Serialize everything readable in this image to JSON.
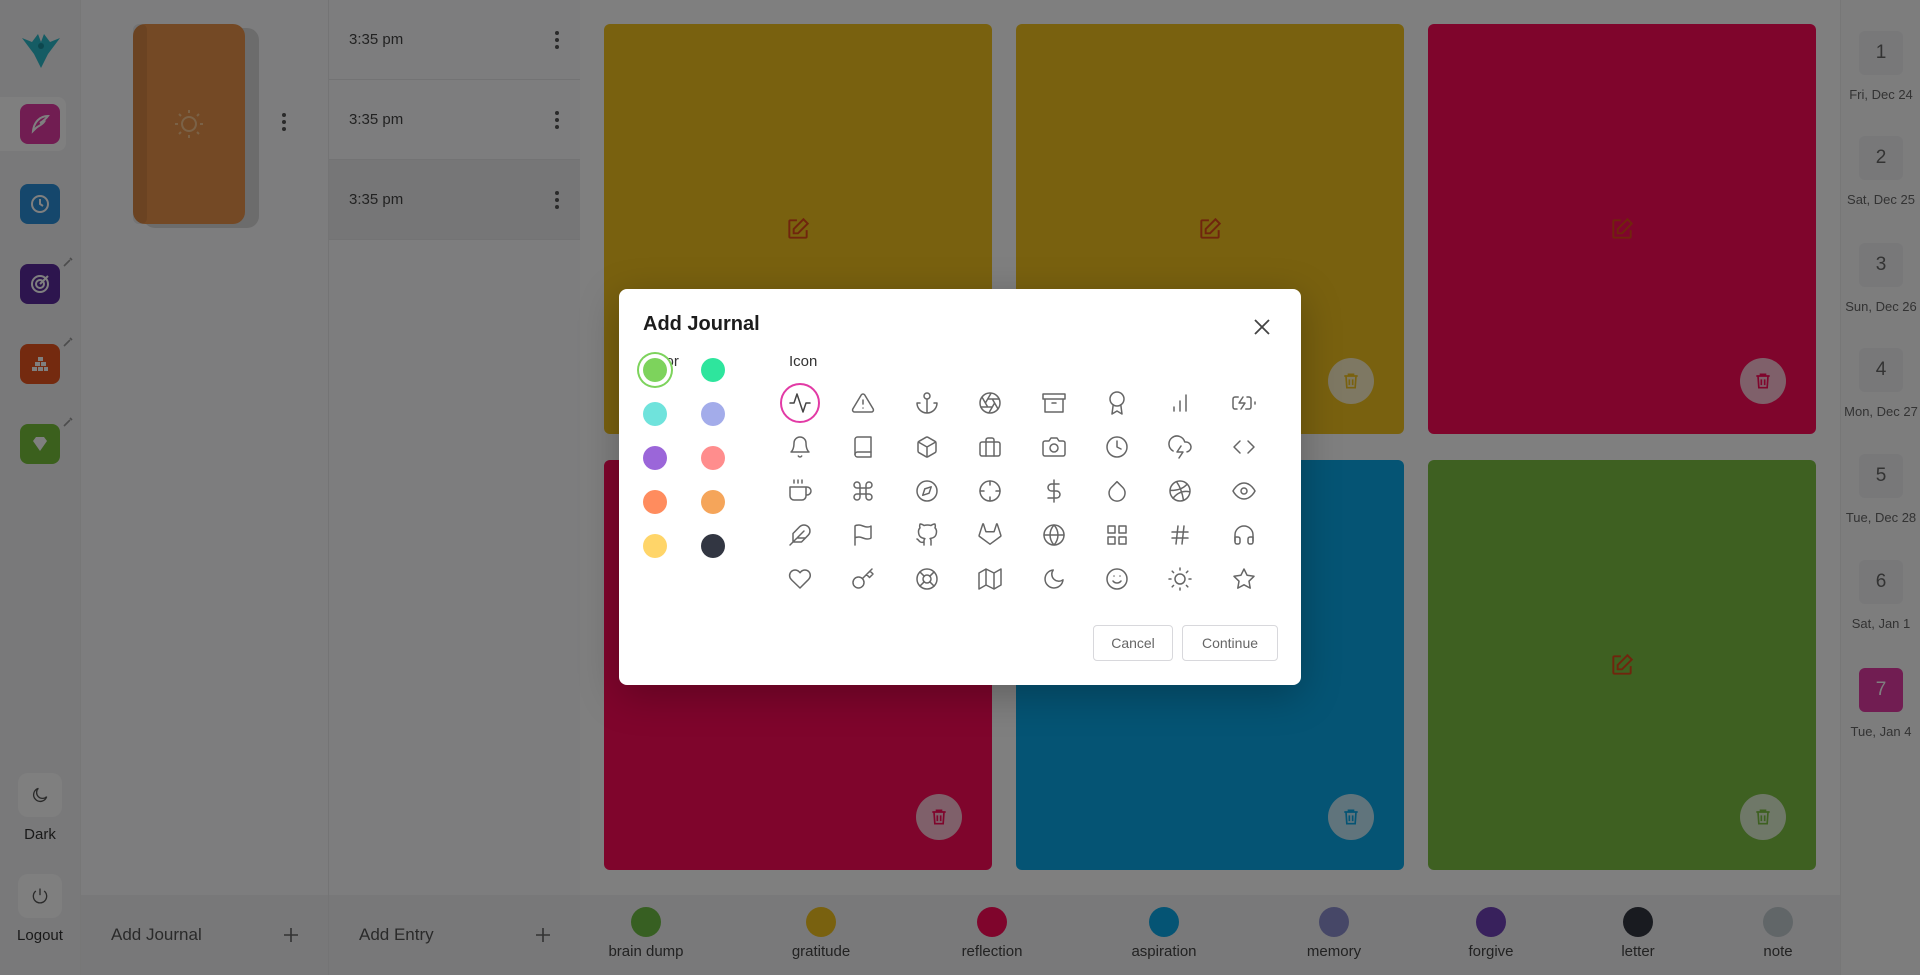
{
  "sidebar": {
    "apps": [
      {
        "name": "journal",
        "color": "#e23aa5",
        "active": true
      },
      {
        "name": "history",
        "color": "#2a8fd8"
      },
      {
        "name": "goals",
        "color": "#5b2a9c"
      },
      {
        "name": "habits",
        "color": "#e8551e"
      },
      {
        "name": "gems",
        "color": "#76c03a"
      }
    ],
    "mode_label": "Dark",
    "logout_label": "Logout"
  },
  "journals": {
    "book_color": "#e9934a",
    "add_label": "Add Journal"
  },
  "entries": {
    "items": [
      {
        "time": "3:35 pm"
      },
      {
        "time": "3:35 pm"
      },
      {
        "time": "3:35 pm"
      }
    ],
    "add_label": "Add Entry"
  },
  "cards": [
    {
      "color": "#f2c31e"
    },
    {
      "color": "#f2c31e"
    },
    {
      "color": "#ff0a58"
    },
    {
      "color": "#ff0a58"
    },
    {
      "color": "#0aa8e8"
    },
    {
      "color": "#7cc143"
    }
  ],
  "legend": [
    {
      "label": "brain dump",
      "color": "#6fbe45"
    },
    {
      "label": "gratitude",
      "color": "#f2c31e"
    },
    {
      "label": "reflection",
      "color": "#ff0a58"
    },
    {
      "label": "aspiration",
      "color": "#0aa8e8"
    },
    {
      "label": "memory",
      "color": "#8c8fcf"
    },
    {
      "label": "forgive",
      "color": "#7043b8"
    },
    {
      "label": "letter",
      "color": "#333640"
    },
    {
      "label": "note",
      "color": "#c3ccd0"
    }
  ],
  "calendar": [
    {
      "num": "1",
      "date": "Fri, Dec 24"
    },
    {
      "num": "2",
      "date": "Sat, Dec 25"
    },
    {
      "num": "3",
      "date": "Sun, Dec 26"
    },
    {
      "num": "4",
      "date": "Mon, Dec 27"
    },
    {
      "num": "5",
      "date": "Tue, Dec 28"
    },
    {
      "num": "6",
      "date": "Sat, Jan 1"
    },
    {
      "num": "7",
      "date": "Tue, Jan 4",
      "active": true
    }
  ],
  "modal": {
    "title": "Add Journal",
    "color_label": "Color",
    "icon_label": "Icon",
    "colors": [
      "#7dd35c",
      "#2ee59d",
      "#6fe3dc",
      "#a3acea",
      "#9b66d9",
      "#ff8d8d",
      "#ff8c5e",
      "#f5a55a",
      "#ffd569",
      "#323642"
    ],
    "icons": [
      "activity",
      "alert-triangle",
      "anchor",
      "aperture",
      "archive",
      "award",
      "bar-chart",
      "battery-charging",
      "bell",
      "book",
      "box",
      "briefcase",
      "camera",
      "clock",
      "cloud-lightning",
      "code",
      "coffee",
      "command",
      "compass",
      "crosshair",
      "dollar-sign",
      "droplet",
      "dribbble",
      "eye",
      "feather",
      "flag",
      "github",
      "gitlab",
      "globe",
      "grid",
      "hash",
      "headphones",
      "heart",
      "key",
      "life-buoy",
      "map",
      "moon",
      "smile",
      "sun",
      "star"
    ],
    "cancel_label": "Cancel",
    "continue_label": "Continue"
  }
}
